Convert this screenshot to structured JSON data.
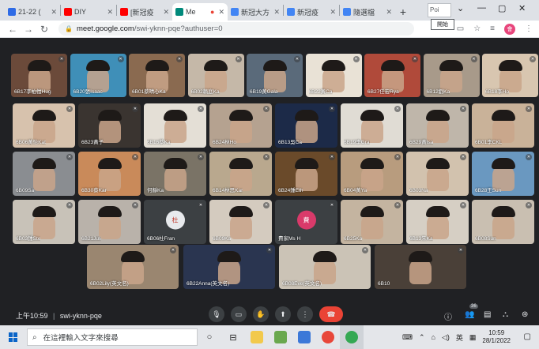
{
  "browser": {
    "tabs": [
      {
        "label": "21-22 (",
        "favicon_color": "#2e6be6"
      },
      {
        "label": "DIY",
        "favicon_color": "#ff0000"
      },
      {
        "label": "[新冠疫",
        "favicon_color": "#ff0000"
      },
      {
        "label": "Me",
        "favicon_color": "#00897b",
        "active": true
      },
      {
        "label": "新冠大方",
        "favicon_color": "#4285f4"
      },
      {
        "label": "新冠疫",
        "favicon_color": "#4285f4"
      },
      {
        "label": "隨選檔",
        "favicon_color": "#4285f4"
      }
    ],
    "new_tab": "+",
    "tooltip": "Poi",
    "popup_hint": "開始",
    "url_host": "meet.google.com",
    "url_path": "/swi-yknn-pqe?authuser=0",
    "profile_initial": "會"
  },
  "meet": {
    "participants": [
      {
        "name": "6B17李柏愷Hug",
        "bg": "#6b4a3a"
      },
      {
        "name": "6B20張Isaac",
        "bg": "#3f8fb8"
      },
      {
        "name": "6B01蔡晴心Ka",
        "bg": "#8a6a50"
      },
      {
        "name": "6B02賴庭Ka",
        "bg": "#c5b8a8"
      },
      {
        "name": "6B19黃Gala",
        "bg": "#5a6a7a"
      },
      {
        "name": "6B22黃Ca",
        "bg": "#e9e2d6"
      },
      {
        "name": "6B27任宏Rya",
        "bg": "#b04a3a"
      },
      {
        "name": "6B12劉Ka",
        "bg": "#a89a8a"
      },
      {
        "name": "6B18李Ho",
        "bg": "#d8c6b0"
      },
      {
        "name": "6B06黃怡Kat",
        "bg": "#d7c2ad"
      },
      {
        "name": "6B23黃子",
        "bg": "#3a3430"
      },
      {
        "name": "6B16蔡Ka",
        "bg": "#e4dfd6"
      },
      {
        "name": "6B24林Ho",
        "bg": "#b5a290"
      },
      {
        "name": "6B13吳Ca",
        "bg": "#1c2a48"
      },
      {
        "name": "6B19李Gra",
        "bg": "#e0dcd4"
      },
      {
        "name": "6B29黃Isa",
        "bg": "#bfb6aa"
      },
      {
        "name": "6B01李CKL",
        "bg": "#c9b299"
      },
      {
        "name": "6B09Sa",
        "bg": "#8a8d91"
      },
      {
        "name": "6B30蔡Kar",
        "bg": "#c98a5a"
      },
      {
        "name": "何靜Ka",
        "bg": "#7a7366"
      },
      {
        "name": "6B14林思Kar",
        "bg": "#b9a88e"
      },
      {
        "name": "6B24鍾Eth",
        "bg": "#6a4a2a"
      },
      {
        "name": "6B04黃Ya",
        "bg": "#b89c7e"
      },
      {
        "name": "6B03Na",
        "bg": "#d2c2ae"
      },
      {
        "name": "6B28王Sun",
        "bg": "#6a98c0"
      },
      {
        "name": "6B03鍾Ste",
        "bg": "#c8c2b8"
      },
      {
        "name": "6B21Juli",
        "bg": "#b9b2aa"
      },
      {
        "name": "6B06杜Fran",
        "bg": "#3c4043",
        "avatar": "杜",
        "avatar_color": "#e8eaed"
      },
      {
        "name": "6B09Ka",
        "bg": "#d4cbbf"
      },
      {
        "name": "費家Ms H",
        "bg": "#3c4043",
        "avatar": "費",
        "avatar_color": "#d93a6a"
      },
      {
        "name": "6B25Ka",
        "bg": "#c4b4a0"
      },
      {
        "name": "6B13朱Ka",
        "bg": "#d6cfc4"
      },
      {
        "name": "6B08Sun",
        "bg": "#c9bfb1"
      },
      {
        "name": "6B02Lily(英文名)",
        "bg": "#9a8670"
      },
      {
        "name": "6B22Anna(英文名)",
        "bg": "#2a3550"
      },
      {
        "name": "6B08Eve(英文名)",
        "bg": "#cbc3b6"
      },
      {
        "name": "6B10",
        "bg": "#4a4038"
      }
    ]
  },
  "controls": {
    "time": "上午10:59",
    "separator": "|",
    "meeting_code": "swi-yknn-pqe",
    "participant_count": "36"
  },
  "taskbar": {
    "search_placeholder": "在這裡輸入文字來搜尋",
    "ime": "英",
    "clock_time": "10:59",
    "clock_date": "28/1/2022"
  }
}
